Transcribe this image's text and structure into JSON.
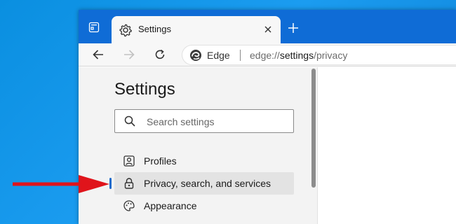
{
  "browser": {
    "tab_title": "Settings",
    "address": {
      "site_name": "Edge",
      "url_scheme": "edge://",
      "url_host": "settings",
      "url_path": "/privacy"
    }
  },
  "settings": {
    "title": "Settings",
    "search_placeholder": "Search settings",
    "nav_items": [
      {
        "label": "Profiles",
        "icon": "profile-icon",
        "selected": false
      },
      {
        "label": "Privacy, search, and services",
        "icon": "lock-icon",
        "selected": true
      },
      {
        "label": "Appearance",
        "icon": "appearance-icon",
        "selected": false
      }
    ]
  },
  "annotation": {
    "arrow_color": "#e0141b"
  },
  "colors": {
    "tabstrip": "#0f6cd6",
    "accent": "#1f6bcc",
    "desktop": "#0a8fe0"
  }
}
